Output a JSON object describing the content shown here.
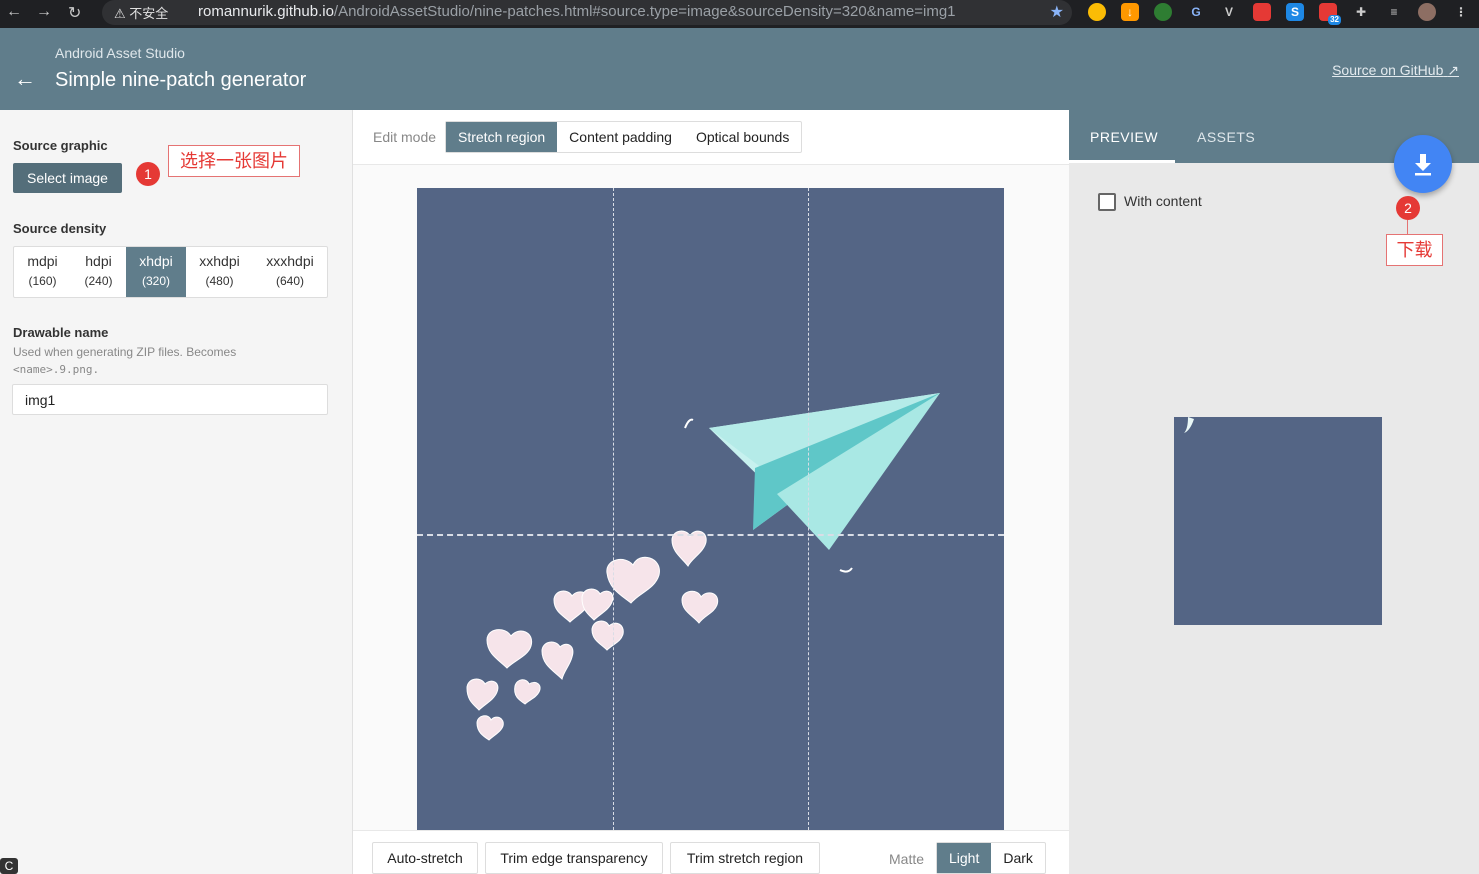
{
  "browser": {
    "security_label": "不安全",
    "url_host": "romannurik.github.io",
    "url_path": "/AndroidAssetStudio/nine-patches.html#source.type=image&sourceDensity=320&name=img1",
    "ext_badge": "32"
  },
  "header": {
    "subtitle": "Android Asset Studio",
    "title": "Simple nine-patch generator",
    "github_link": "Source on GitHub"
  },
  "sidebar": {
    "source_graphic_label": "Source graphic",
    "select_image_button": "Select image",
    "annotation_1_number": "1",
    "annotation_1_text": "选择一张图片",
    "source_density_label": "Source density",
    "densities": [
      {
        "name": "mdpi",
        "dpi": "(160)"
      },
      {
        "name": "hdpi",
        "dpi": "(240)"
      },
      {
        "name": "xhdpi",
        "dpi": "(320)"
      },
      {
        "name": "xxhdpi",
        "dpi": "(480)"
      },
      {
        "name": "xxxhdpi",
        "dpi": "(640)"
      }
    ],
    "selected_density": "xhdpi",
    "drawable_name_label": "Drawable name",
    "drawable_help_1": "Used when generating ZIP files. Becomes",
    "drawable_help_2": "<name>.9.png.",
    "drawable_name_value": "img1"
  },
  "editor": {
    "edit_mode_label": "Edit mode",
    "modes": [
      "Stretch region",
      "Content padding",
      "Optical bounds"
    ],
    "active_mode": "Stretch region",
    "bottom_buttons": [
      "Auto-stretch",
      "Trim edge transparency",
      "Trim stretch region"
    ],
    "matte_label": "Matte",
    "matte_options": [
      "Light",
      "Dark"
    ],
    "active_matte": "Light"
  },
  "preview_panel": {
    "tabs": [
      "PREVIEW",
      "ASSETS"
    ],
    "active_tab": "PREVIEW",
    "with_content_label": "With content",
    "with_content_checked": false,
    "annotation_2_number": "2",
    "annotation_2_text": "下载"
  },
  "colors": {
    "appbar": "#607d8b",
    "image_bg": "#546585",
    "fab": "#4285f4",
    "annotation": "#e53935"
  }
}
